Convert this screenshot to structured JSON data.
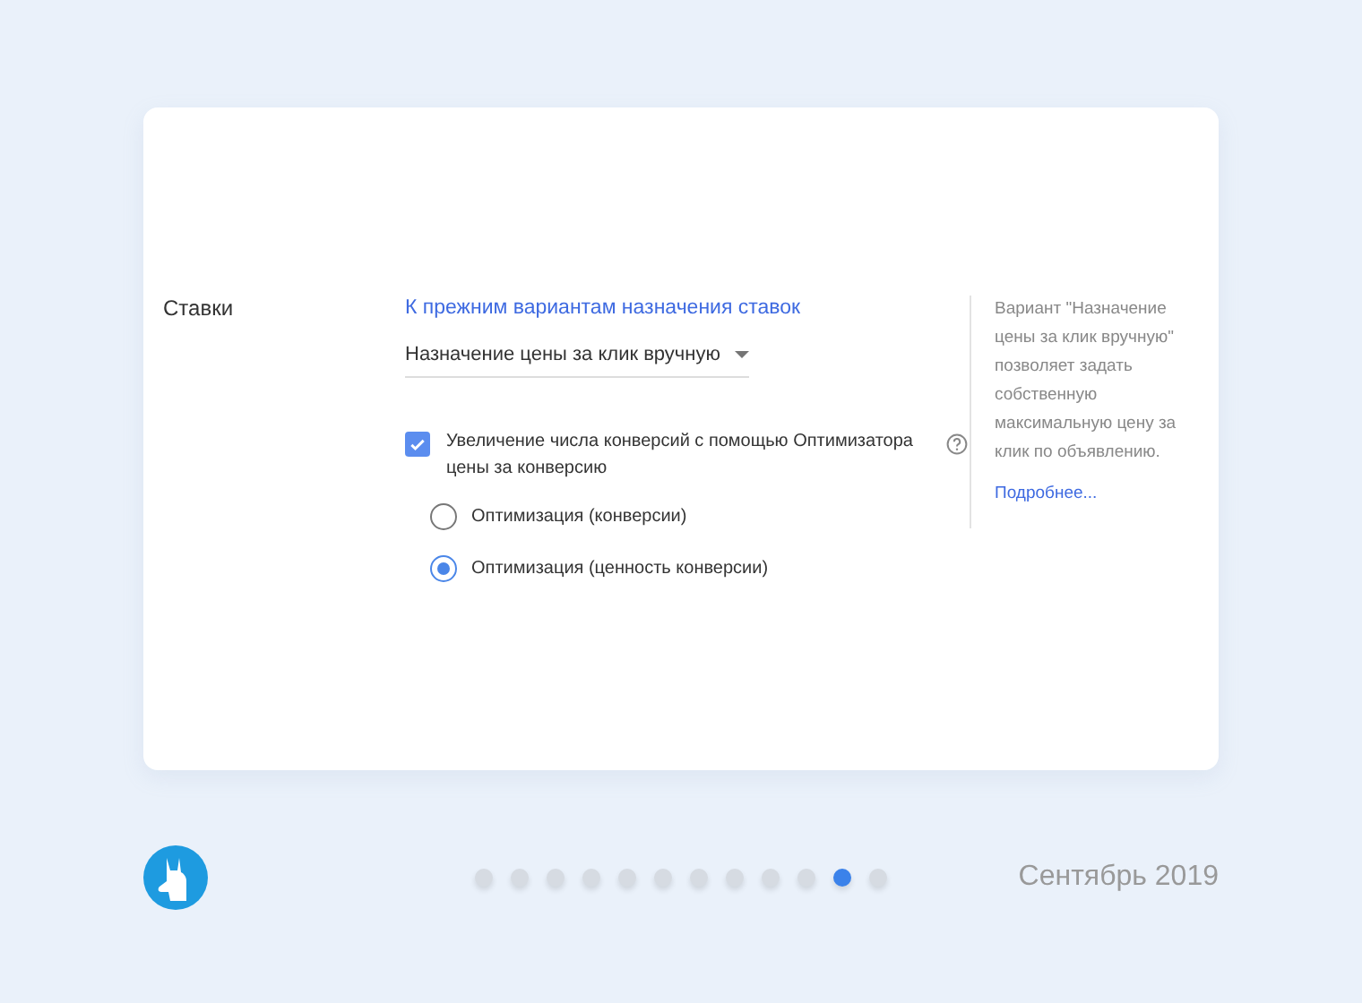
{
  "section_label": "Ставки",
  "legacy_link": "К прежним вариантам назначения ставок",
  "strategy_dropdown": {
    "value": "Назначение цены за клик вручную"
  },
  "enhanced_cpc": {
    "label": "Увеличение числа конверсий с помощью Оптимизатора цены за конверсию",
    "checked": true
  },
  "options": [
    {
      "label": "Оптимизация (конверсии)",
      "selected": false
    },
    {
      "label": "Оптимизация (ценность конверсии)",
      "selected": true
    }
  ],
  "help": {
    "text": "Вариант \"Назначение цены за клик вручную\" позволяет задать собственную максимальную цену за клик по объявлению.",
    "link": "Подробнее..."
  },
  "pager": [
    {
      "selected": false
    },
    {
      "selected": false
    },
    {
      "selected": false
    },
    {
      "selected": false
    },
    {
      "selected": false
    },
    {
      "selected": false
    },
    {
      "selected": false
    },
    {
      "selected": false
    },
    {
      "selected": false
    },
    {
      "selected": false
    },
    {
      "selected": true
    },
    {
      "selected": false
    }
  ],
  "date": "Сентябрь 2019"
}
